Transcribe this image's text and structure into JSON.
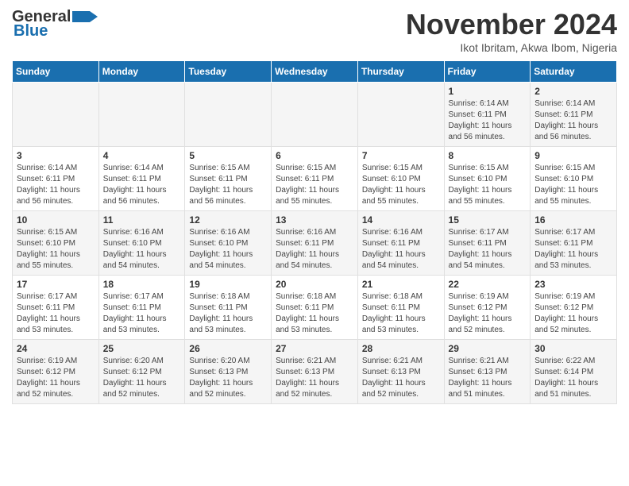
{
  "header": {
    "logo_line1": "General",
    "logo_line2": "Blue",
    "month_title": "November 2024",
    "location": "Ikot Ibritam, Akwa Ibom, Nigeria"
  },
  "weekdays": [
    "Sunday",
    "Monday",
    "Tuesday",
    "Wednesday",
    "Thursday",
    "Friday",
    "Saturday"
  ],
  "weeks": [
    [
      {
        "day": "",
        "info": ""
      },
      {
        "day": "",
        "info": ""
      },
      {
        "day": "",
        "info": ""
      },
      {
        "day": "",
        "info": ""
      },
      {
        "day": "",
        "info": ""
      },
      {
        "day": "1",
        "info": "Sunrise: 6:14 AM\nSunset: 6:11 PM\nDaylight: 11 hours and 56 minutes."
      },
      {
        "day": "2",
        "info": "Sunrise: 6:14 AM\nSunset: 6:11 PM\nDaylight: 11 hours and 56 minutes."
      }
    ],
    [
      {
        "day": "3",
        "info": "Sunrise: 6:14 AM\nSunset: 6:11 PM\nDaylight: 11 hours and 56 minutes."
      },
      {
        "day": "4",
        "info": "Sunrise: 6:14 AM\nSunset: 6:11 PM\nDaylight: 11 hours and 56 minutes."
      },
      {
        "day": "5",
        "info": "Sunrise: 6:15 AM\nSunset: 6:11 PM\nDaylight: 11 hours and 56 minutes."
      },
      {
        "day": "6",
        "info": "Sunrise: 6:15 AM\nSunset: 6:11 PM\nDaylight: 11 hours and 55 minutes."
      },
      {
        "day": "7",
        "info": "Sunrise: 6:15 AM\nSunset: 6:10 PM\nDaylight: 11 hours and 55 minutes."
      },
      {
        "day": "8",
        "info": "Sunrise: 6:15 AM\nSunset: 6:10 PM\nDaylight: 11 hours and 55 minutes."
      },
      {
        "day": "9",
        "info": "Sunrise: 6:15 AM\nSunset: 6:10 PM\nDaylight: 11 hours and 55 minutes."
      }
    ],
    [
      {
        "day": "10",
        "info": "Sunrise: 6:15 AM\nSunset: 6:10 PM\nDaylight: 11 hours and 55 minutes."
      },
      {
        "day": "11",
        "info": "Sunrise: 6:16 AM\nSunset: 6:10 PM\nDaylight: 11 hours and 54 minutes."
      },
      {
        "day": "12",
        "info": "Sunrise: 6:16 AM\nSunset: 6:10 PM\nDaylight: 11 hours and 54 minutes."
      },
      {
        "day": "13",
        "info": "Sunrise: 6:16 AM\nSunset: 6:11 PM\nDaylight: 11 hours and 54 minutes."
      },
      {
        "day": "14",
        "info": "Sunrise: 6:16 AM\nSunset: 6:11 PM\nDaylight: 11 hours and 54 minutes."
      },
      {
        "day": "15",
        "info": "Sunrise: 6:17 AM\nSunset: 6:11 PM\nDaylight: 11 hours and 54 minutes."
      },
      {
        "day": "16",
        "info": "Sunrise: 6:17 AM\nSunset: 6:11 PM\nDaylight: 11 hours and 53 minutes."
      }
    ],
    [
      {
        "day": "17",
        "info": "Sunrise: 6:17 AM\nSunset: 6:11 PM\nDaylight: 11 hours and 53 minutes."
      },
      {
        "day": "18",
        "info": "Sunrise: 6:17 AM\nSunset: 6:11 PM\nDaylight: 11 hours and 53 minutes."
      },
      {
        "day": "19",
        "info": "Sunrise: 6:18 AM\nSunset: 6:11 PM\nDaylight: 11 hours and 53 minutes."
      },
      {
        "day": "20",
        "info": "Sunrise: 6:18 AM\nSunset: 6:11 PM\nDaylight: 11 hours and 53 minutes."
      },
      {
        "day": "21",
        "info": "Sunrise: 6:18 AM\nSunset: 6:11 PM\nDaylight: 11 hours and 53 minutes."
      },
      {
        "day": "22",
        "info": "Sunrise: 6:19 AM\nSunset: 6:12 PM\nDaylight: 11 hours and 52 minutes."
      },
      {
        "day": "23",
        "info": "Sunrise: 6:19 AM\nSunset: 6:12 PM\nDaylight: 11 hours and 52 minutes."
      }
    ],
    [
      {
        "day": "24",
        "info": "Sunrise: 6:19 AM\nSunset: 6:12 PM\nDaylight: 11 hours and 52 minutes."
      },
      {
        "day": "25",
        "info": "Sunrise: 6:20 AM\nSunset: 6:12 PM\nDaylight: 11 hours and 52 minutes."
      },
      {
        "day": "26",
        "info": "Sunrise: 6:20 AM\nSunset: 6:13 PM\nDaylight: 11 hours and 52 minutes."
      },
      {
        "day": "27",
        "info": "Sunrise: 6:21 AM\nSunset: 6:13 PM\nDaylight: 11 hours and 52 minutes."
      },
      {
        "day": "28",
        "info": "Sunrise: 6:21 AM\nSunset: 6:13 PM\nDaylight: 11 hours and 52 minutes."
      },
      {
        "day": "29",
        "info": "Sunrise: 6:21 AM\nSunset: 6:13 PM\nDaylight: 11 hours and 51 minutes."
      },
      {
        "day": "30",
        "info": "Sunrise: 6:22 AM\nSunset: 6:14 PM\nDaylight: 11 hours and 51 minutes."
      }
    ]
  ]
}
